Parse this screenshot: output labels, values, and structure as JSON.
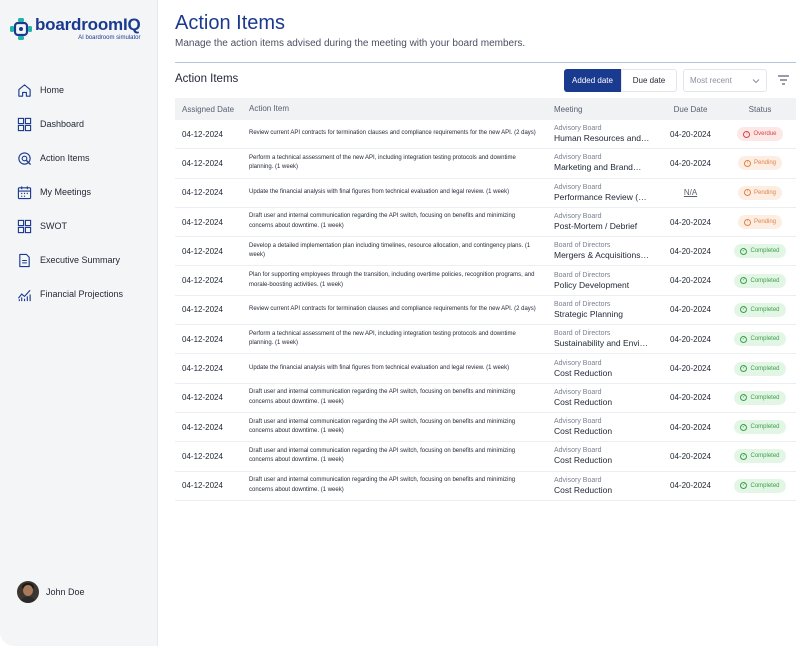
{
  "brand": {
    "name_part1": "boardroom",
    "name_part2": "IQ",
    "tagline": "AI boardroom simulator",
    "primary_color": "#1a3a8f"
  },
  "sidebar": {
    "items": [
      {
        "label": "Home",
        "icon": "home-icon"
      },
      {
        "label": "Dashboard",
        "icon": "dashboard-icon"
      },
      {
        "label": "Action Items",
        "icon": "action-items-icon"
      },
      {
        "label": "My Meetings",
        "icon": "calendar-icon"
      },
      {
        "label": "SWOT",
        "icon": "swot-icon"
      },
      {
        "label": "Executive Summary",
        "icon": "document-icon"
      },
      {
        "label": "Financial Projections",
        "icon": "chart-icon"
      }
    ],
    "user": {
      "name": "John Doe"
    }
  },
  "header": {
    "title": "Action Items",
    "subtitle": "Manage the action items advised during the meeting with your board members."
  },
  "section": {
    "title": "Action Items",
    "sort_buttons": [
      "Added date",
      "Due date"
    ],
    "sort_select": "Most recent"
  },
  "table": {
    "columns": [
      "Assigned Date",
      "Action Item",
      "Meeting",
      "Due Date",
      "Status"
    ],
    "rows": [
      {
        "assigned": "04-12-2024",
        "item": "Review current API contracts for termination clauses and compliance requirements for the new API. (2 days)",
        "meeting_type": "Advisory Board",
        "meeting_name": "Human Resources and…",
        "due": "04-20-2024",
        "status": "Overdue"
      },
      {
        "assigned": "04-12-2024",
        "item": "Perform a technical assessment of the new API, including integration testing protocols and downtime planning. (1 week)",
        "meeting_type": "Advisory Board",
        "meeting_name": "Marketing and Brand…",
        "due": "04-20-2024",
        "status": "Pending"
      },
      {
        "assigned": "04-12-2024",
        "item": "Update the financial analysis with final figures from technical evaluation and legal review. (1 week)",
        "meeting_type": "Advisory Board",
        "meeting_name": "Performance Review (…",
        "due": "N/A",
        "status": "Pending"
      },
      {
        "assigned": "04-12-2024",
        "item": "Draft user and internal communication regarding the API switch, focusing on benefits and minimizing concerns about downtime. (1 week)",
        "meeting_type": "Advisory Board",
        "meeting_name": "Post-Mortem / Debrief",
        "due": "04-20-2024",
        "status": "Pending"
      },
      {
        "assigned": "04-12-2024",
        "item": "Develop a detailed implementation plan including timelines, resource allocation, and contingency plans. (1 week)",
        "meeting_type": "Board of Directors",
        "meeting_name": "Mergers & Acquisitions…",
        "due": "04-20-2024",
        "status": "Completed"
      },
      {
        "assigned": "04-12-2024",
        "item": "Plan for supporting employees through the transition, including overtime policies, recognition programs, and morale-boosting activities. (1 week)",
        "meeting_type": "Board of Directors",
        "meeting_name": "Policy Development",
        "due": "04-20-2024",
        "status": "Completed"
      },
      {
        "assigned": "04-12-2024",
        "item": "Review current API contracts for termination clauses and compliance requirements for the new API. (2 days)",
        "meeting_type": "Board of Directors",
        "meeting_name": "Strategic Planning",
        "due": "04-20-2024",
        "status": "Completed"
      },
      {
        "assigned": "04-12-2024",
        "item": "Perform a technical assessment of the new API, including integration testing protocols and downtime planning. (1 week)",
        "meeting_type": "Board of Directors",
        "meeting_name": "Sustainability and Envi…",
        "due": "04-20-2024",
        "status": "Completed"
      },
      {
        "assigned": "04-12-2024",
        "item": "Update the financial analysis with final figures from technical evaluation and legal review. (1 week)",
        "meeting_type": "Advisory Board",
        "meeting_name": "Cost Reduction",
        "due": "04-20-2024",
        "status": "Completed"
      },
      {
        "assigned": "04-12-2024",
        "item": "Draft user and internal communication regarding the API switch, focusing on benefits and minimizing concerns about downtime. (1 week)",
        "meeting_type": "Advisory Board",
        "meeting_name": "Cost Reduction",
        "due": "04-20-2024",
        "status": "Completed"
      },
      {
        "assigned": "04-12-2024",
        "item": "Draft user and internal communication regarding the API switch, focusing on benefits and minimizing concerns about downtime. (1 week)",
        "meeting_type": "Advisory Board",
        "meeting_name": "Cost Reduction",
        "due": "04-20-2024",
        "status": "Completed"
      },
      {
        "assigned": "04-12-2024",
        "item": "Draft user and internal communication regarding the API switch, focusing on benefits and minimizing concerns about downtime. (1 week)",
        "meeting_type": "Advisory Board",
        "meeting_name": "Cost Reduction",
        "due": "04-20-2024",
        "status": "Completed"
      },
      {
        "assigned": "04-12-2024",
        "item": "Draft user and internal communication regarding the API switch, focusing on benefits and minimizing concerns about downtime. (1 week)",
        "meeting_type": "Advisory Board",
        "meeting_name": "Cost Reduction",
        "due": "04-20-2024",
        "status": "Completed"
      }
    ]
  },
  "status_colors": {
    "Overdue": "#d64545",
    "Pending": "#e0824a",
    "Completed": "#3aa14a"
  }
}
